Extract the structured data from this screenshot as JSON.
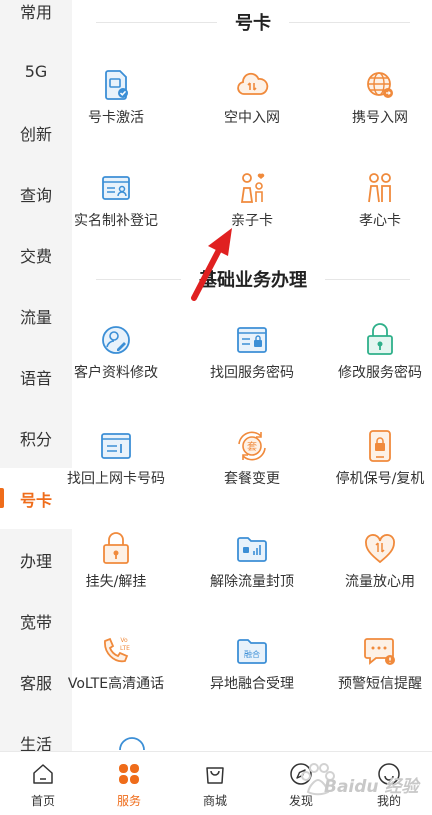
{
  "sidebar": {
    "items": [
      {
        "label": "常用"
      },
      {
        "label": "5G"
      },
      {
        "label": "创新"
      },
      {
        "label": "查询"
      },
      {
        "label": "交费"
      },
      {
        "label": "流量"
      },
      {
        "label": "语音"
      },
      {
        "label": "积分"
      },
      {
        "label": "号卡",
        "active": true
      },
      {
        "label": "办理"
      },
      {
        "label": "宽带"
      },
      {
        "label": "客服"
      },
      {
        "label": "生活"
      }
    ]
  },
  "sections": {
    "haoka": {
      "title": "号卡",
      "items": [
        {
          "label": "号卡激活",
          "icon": "sim-activate-icon"
        },
        {
          "label": "空中入网",
          "icon": "cloud-icon"
        },
        {
          "label": "携号入网",
          "icon": "globe-icon"
        },
        {
          "label": "实名制补登记",
          "icon": "id-card-icon"
        },
        {
          "label": "亲子卡",
          "icon": "parent-child-icon"
        },
        {
          "label": "孝心卡",
          "icon": "elderly-couple-icon"
        }
      ]
    },
    "basic": {
      "title": "基础业务办理",
      "items": [
        {
          "label": "客户资料修改",
          "icon": "profile-edit-icon"
        },
        {
          "label": "找回服务密码",
          "icon": "password-window-icon"
        },
        {
          "label": "修改服务密码",
          "icon": "lock-key-icon"
        },
        {
          "label": "找回上网卡号码",
          "icon": "card-window-icon"
        },
        {
          "label": "套餐变更",
          "icon": "package-change-icon"
        },
        {
          "label": "停机保号/复机",
          "icon": "phone-lock-icon"
        },
        {
          "label": "挂失/解挂",
          "icon": "padlock-icon"
        },
        {
          "label": "解除流量封顶",
          "icon": "data-folder-icon"
        },
        {
          "label": "流量放心用",
          "icon": "heart-data-icon"
        },
        {
          "label": "VoLTE高清通话",
          "icon": "volte-phone-icon"
        },
        {
          "label": "异地融合受理",
          "icon": "merge-folder-icon"
        },
        {
          "label": "预警短信提醒",
          "icon": "sms-alert-icon"
        }
      ]
    }
  },
  "tabbar": {
    "items": [
      {
        "label": "首页",
        "icon": "home-icon"
      },
      {
        "label": "服务",
        "icon": "grid-icon",
        "active": true
      },
      {
        "label": "商城",
        "icon": "shopping-bag-icon"
      },
      {
        "label": "发现",
        "icon": "compass-icon"
      },
      {
        "label": "我的",
        "icon": "profile-icon"
      }
    ]
  },
  "colors": {
    "accent": "#ef6c1a",
    "icon_blue": "#3c8fd6",
    "icon_orange": "#f08a3c",
    "icon_green": "#2fb08a",
    "annotation_arrow": "#e02020"
  },
  "watermark": {
    "text": "Baidu 经验"
  }
}
